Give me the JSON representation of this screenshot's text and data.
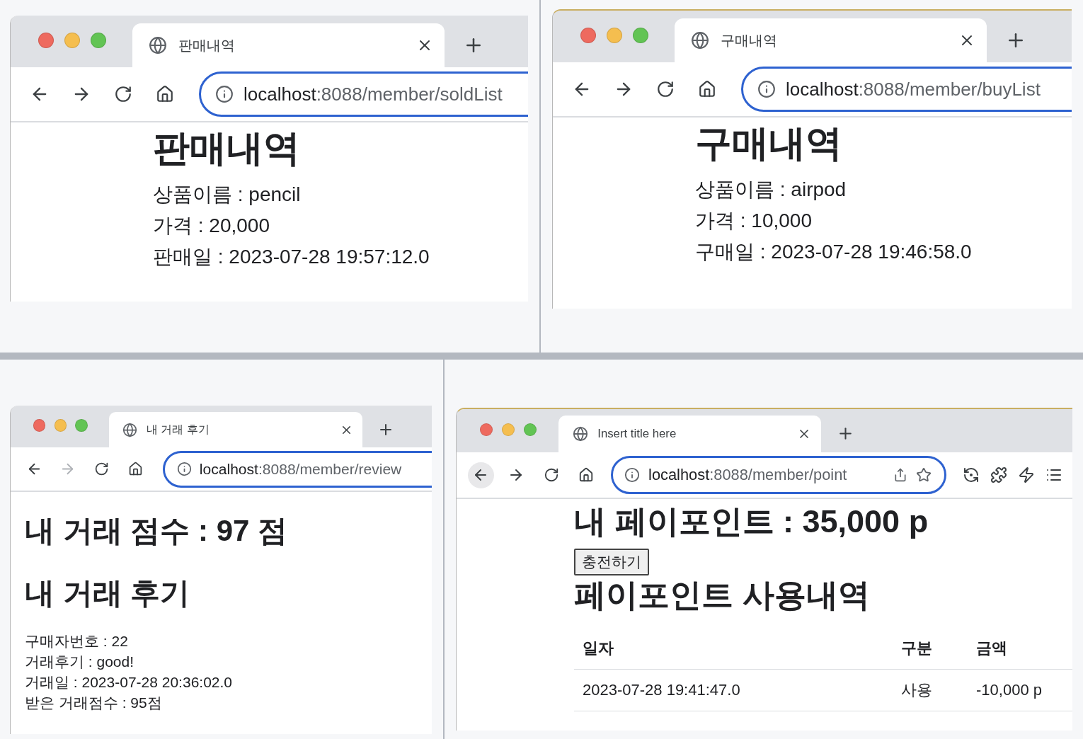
{
  "windows": [
    {
      "tab": {
        "title": "판매내역"
      },
      "url": {
        "host": "localhost",
        "rest": ":8088/member/soldList"
      },
      "forward_disabled": false,
      "back_hovered": false,
      "extensions": false,
      "content": {
        "kind": "listing",
        "heading": "판매내역",
        "lines": [
          "상품이름 : pencil",
          "가격 : 20,000",
          "판매일 : 2023-07-28 19:57:12.0"
        ]
      }
    },
    {
      "tab": {
        "title": "구매내역"
      },
      "url": {
        "host": "localhost",
        "rest": ":8088/member/buyList"
      },
      "forward_disabled": false,
      "back_hovered": false,
      "extensions": false,
      "content": {
        "kind": "listing",
        "heading": "구매내역",
        "lines": [
          "상품이름 : airpod",
          "가격 : 10,000",
          "구매일 : 2023-07-28 19:46:58.0"
        ]
      }
    },
    {
      "tab": {
        "title": "내 거래 후기"
      },
      "url": {
        "host": "localhost",
        "rest": ":8088/member/review"
      },
      "forward_disabled": true,
      "back_hovered": false,
      "extensions": false,
      "content": {
        "kind": "review",
        "score_heading": "내 거래 점수 : 97 점",
        "review_heading": "내 거래 후기",
        "lines": [
          "구매자번호 : 22",
          "거래후기 : good!",
          "거래일 : 2023-07-28 20:36:02.0",
          "받은 거래점수 : 95점"
        ]
      }
    },
    {
      "tab": {
        "title": "Insert title here"
      },
      "url": {
        "host": "localhost",
        "rest": ":8088/member/point"
      },
      "forward_disabled": false,
      "back_hovered": true,
      "extensions": true,
      "content": {
        "kind": "points",
        "heading": "내 페이포인트 : 35,000 p",
        "button": "충전하기",
        "subheading": "페이포인트 사용내역",
        "table": {
          "columns": [
            "일자",
            "구분",
            "금액"
          ],
          "rows": [
            [
              "2023-07-28 19:41:47.0",
              "사용",
              "-10,000 p"
            ]
          ]
        }
      }
    }
  ]
}
